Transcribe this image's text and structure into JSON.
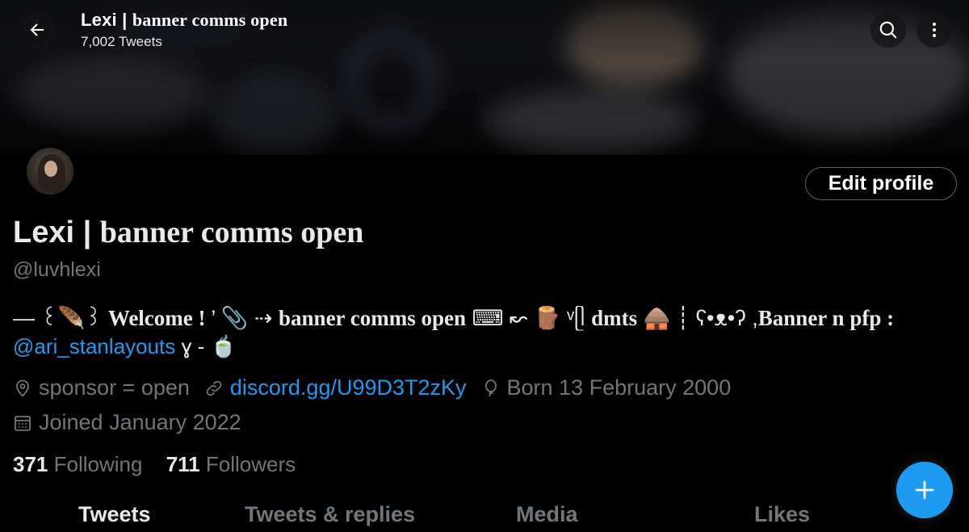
{
  "header": {
    "name_plain": "Lexi | ",
    "name_styled": "banner comms open",
    "tweet_count": "7,002 Tweets"
  },
  "profile": {
    "edit_label": "Edit profile",
    "name_plain": "Lexi | ",
    "name_styled": "banner comms open",
    "handle": "@luvhlexi",
    "bio_line1_prefix": "— ꒰🪶꒱ ",
    "bio_line1_welcome": "Welcome ! ",
    "bio_line1_mid": "’ 📎 ⇢ ",
    "bio_line1_comms": "banner comms open",
    "bio_line1_keyboard": " ⌨ ↜ 🪵 ᵛᥫ ",
    "bio_line1_dmts": "dmts",
    "bio_line1_hut": " 🛖 ┊ ʕ•ᴥ•ʔ ,",
    "bio_line1_bannerpfp": "Banner n pfp :",
    "bio_mention": "@ari_stanlayouts",
    "bio_line2_suffix": " ɣ - 🍵"
  },
  "meta": {
    "location": "sponsor = open",
    "website": "discord.gg/U99D3T2zKy",
    "birthday": "Born 13 February 2000",
    "joined": "Joined January 2022"
  },
  "stats": {
    "following_count": "371",
    "following_label": "Following",
    "followers_count": "711",
    "followers_label": "Followers"
  },
  "tabs": [
    "Tweets",
    "Tweets & replies",
    "Media",
    "Likes"
  ],
  "icons": {
    "back": "back-arrow-icon",
    "search": "search-icon",
    "more": "more-vertical-icon",
    "location": "location-pin-icon",
    "link": "link-icon",
    "birthday": "balloon-icon",
    "calendar": "calendar-icon",
    "compose": "plus-icon"
  },
  "colors": {
    "accent": "#1d9bf0",
    "muted": "#71767b",
    "text": "#e7e9ea",
    "background": "#000000"
  }
}
